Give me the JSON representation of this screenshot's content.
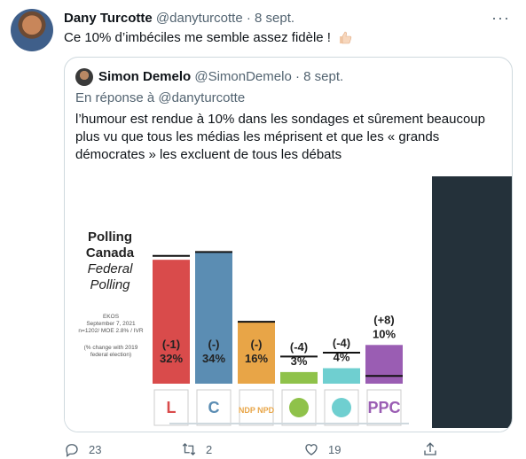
{
  "tweet": {
    "author_name": "Dany Turcotte",
    "author_handle": "@danyturcotte",
    "separator": "·",
    "date": "8 sept.",
    "text": "Ce 10% d’imbéciles me semble assez fidèle !",
    "emoji_icon": "thumbs-up-icon"
  },
  "quoted": {
    "author_name": "Simon Demelo",
    "author_handle": "@SimonDemelo",
    "separator": "·",
    "date": "8 sept.",
    "reply_to": "En réponse à @danyturcotte",
    "text": "l’humour est rendue à 10% dans les sondages et sûrement beaucoup plus vu que tous les médias les méprisent et que les « grands démocrates » les excluent de tous les débats"
  },
  "poll_image": {
    "title_line1": "Polling",
    "title_line2": "Canada",
    "subtitle_line1": "Federal",
    "subtitle_line2": "Polling",
    "source_line1": "EKOS",
    "source_line2": "September 7, 2021",
    "source_line3": "n=1202/ MOE 2.8% / IVR",
    "note_line1": "(% change with 2019",
    "note_line2": "federal election)"
  },
  "chart_data": {
    "type": "bar",
    "categories": [
      "LPC",
      "CPC",
      "NDP",
      "GPC",
      "BQ",
      "PPC"
    ],
    "values": [
      32,
      34,
      16,
      3,
      4,
      10
    ],
    "value_labels": [
      "32%",
      "34%",
      "16%",
      "3%",
      "4%",
      "10%"
    ],
    "change_labels": [
      "(-1)",
      "(-)",
      "(-)",
      "(-4)",
      "(-4)",
      "(+8)"
    ],
    "logo_texts": [
      "L",
      "C",
      "NDP NPD",
      "",
      "",
      "PPC"
    ],
    "colors": [
      "#d94b4b",
      "#5b8db3",
      "#e8a547",
      "#8fc24a",
      "#6fcfd0",
      "#9a5db3"
    ],
    "ylim": [
      0,
      40
    ],
    "grid": false,
    "legend": "none"
  },
  "actions": {
    "reply_count": "23",
    "retweet_count": "2",
    "like_count": "19"
  }
}
